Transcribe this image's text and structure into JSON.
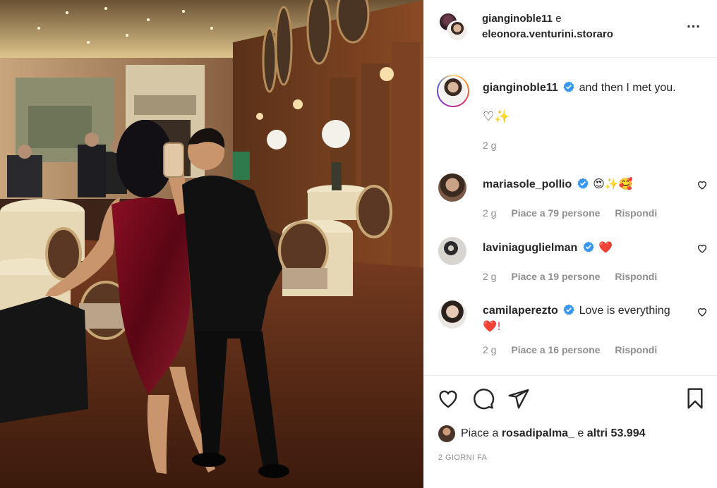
{
  "header": {
    "user1": "gianginoble11",
    "separator": "e",
    "user2": "eleonora.venturini.storaro",
    "more_label": "..."
  },
  "caption": {
    "username": "gianginoble11",
    "text": "and then I met you.",
    "line2": "♡✨",
    "time": "2 g"
  },
  "comments": [
    {
      "username": "mariasole_pollio",
      "text": "😍✨🥰",
      "time": "2 g",
      "likes": "Piace a 79 persone",
      "reply": "Rispondi"
    },
    {
      "username": "laviniaguglielman",
      "text": "❤️",
      "time": "2 g",
      "likes": "Piace a 19 persone",
      "reply": "Rispondi"
    },
    {
      "username": "camilaperezto",
      "text": "Love is everything",
      "text2": "❤️!",
      "time": "2 g",
      "likes": "Piace a 16 persone",
      "reply": "Rispondi"
    }
  ],
  "likes": {
    "prefix": "Piace a ",
    "user": "rosadipalma_",
    "conj": " e ",
    "others": "altri 53.994"
  },
  "date": "2 GIORNI FA",
  "colors": {
    "verified": "#3897f0",
    "meta_text": "#8e8e8e",
    "heart": "#ed4956"
  },
  "icons": [
    "heart-icon",
    "comment-icon",
    "share-icon",
    "bookmark-icon",
    "more-icon",
    "verified-badge-icon"
  ]
}
